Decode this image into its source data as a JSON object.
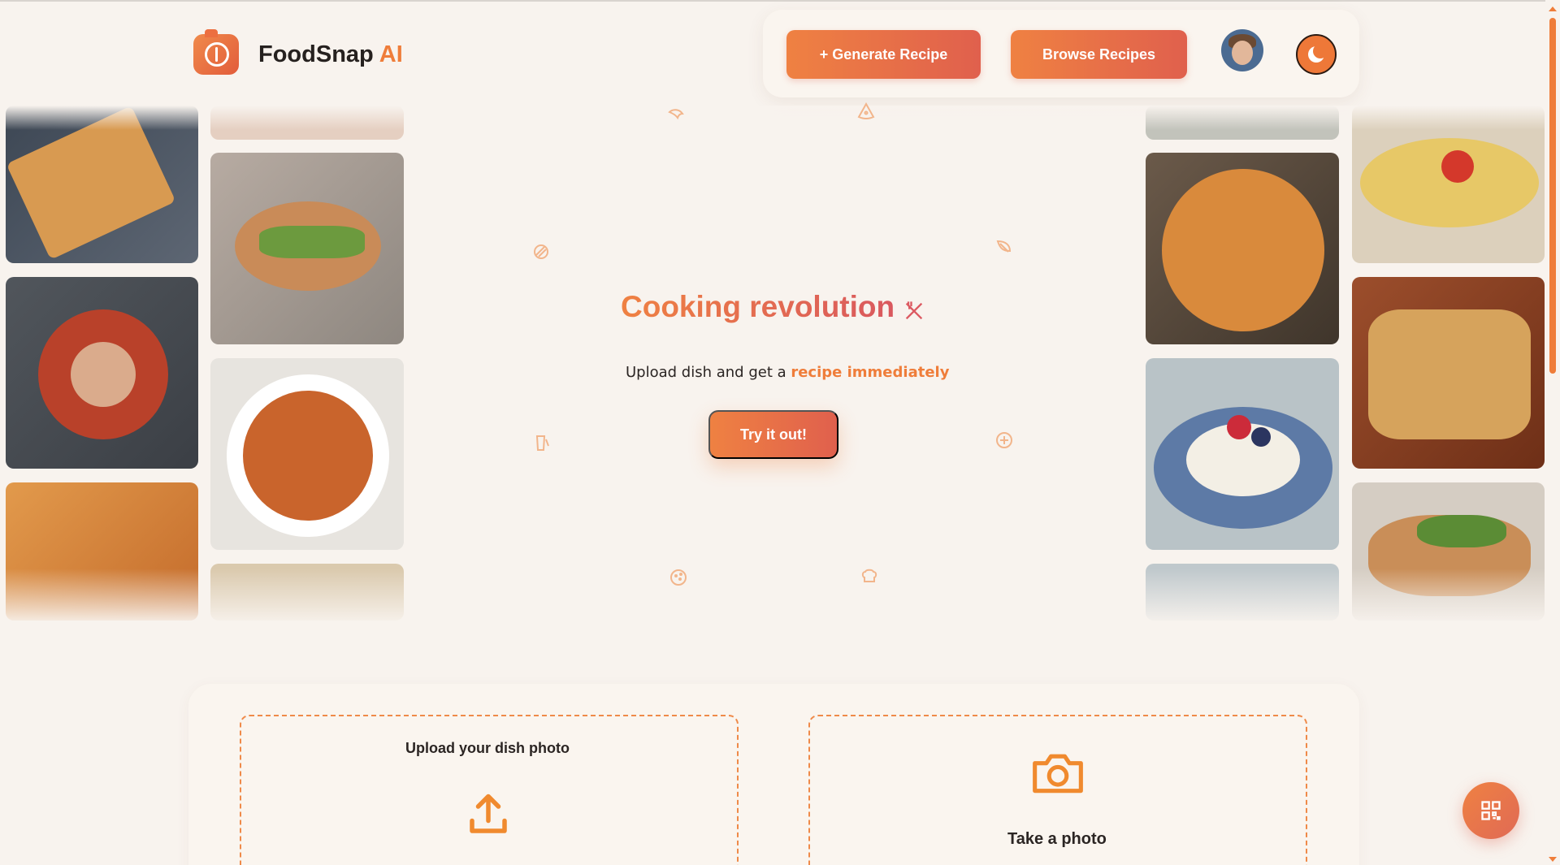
{
  "header": {
    "brand_name": "FoodSnap",
    "brand_suffix": "AI",
    "logo_icon": "camera-fork-icon"
  },
  "nav": {
    "generate_label": "+ Generate Recipe",
    "browse_label": "Browse Recipes",
    "avatar_icon": "user-avatar",
    "theme_icon": "moon-icon"
  },
  "gallery": {
    "left": [
      "grilled cheese sandwich",
      "chicken pita sandwich",
      "tomato stew in pot",
      "vegetable soup",
      "penne pasta",
      "cheese board"
    ],
    "right": [
      "omelette with tomatoes",
      "creamy penne pasta",
      "cheesy quesadilla",
      "panna cotta with berries",
      "chicken sandwich"
    ]
  },
  "hero": {
    "title": "Cooking revolution",
    "subtitle_prefix": "Upload dish and get a ",
    "subtitle_highlight": "recipe immediately",
    "cta_label": "Try it out!"
  },
  "upload": {
    "upload_title": "Upload your dish photo",
    "camera_title": "Take a photo"
  },
  "colors": {
    "accent": "#ef7d3a",
    "accent_end": "#e0604d",
    "background": "#f8f3ee"
  },
  "fab_icon": "qr-code-icon"
}
